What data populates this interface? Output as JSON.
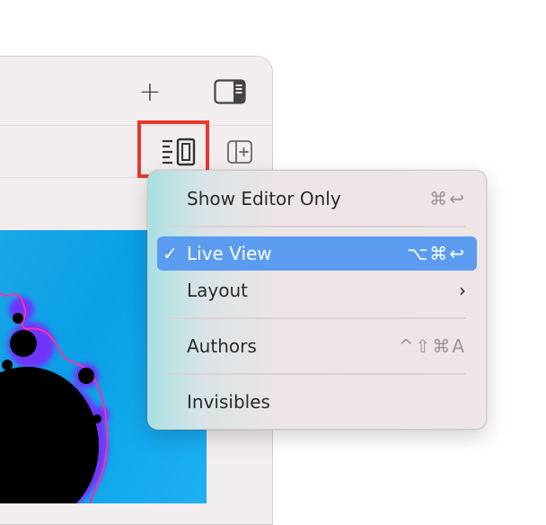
{
  "toolbar": {
    "plus_icon": "plus-icon",
    "plus_glyph": "+",
    "sidebar_icon": "sidebar-toggle-icon",
    "editor_mode_icon": "editor-mode-icon",
    "add_pane_icon": "add-pane-icon"
  },
  "menu": {
    "items": [
      {
        "label": "Show Editor Only",
        "shortcut": "⌘↩",
        "selected": false,
        "checked": false
      },
      {
        "label": "Live View",
        "shortcut": "⌥⌘↩",
        "selected": true,
        "checked": true,
        "check_glyph": "✓"
      },
      {
        "label": "Layout",
        "submenu_glyph": "›",
        "selected": false,
        "checked": false
      },
      {
        "label": "Authors",
        "shortcut": "^⇧⌘A",
        "selected": false,
        "checked": false
      },
      {
        "label": "Invisibles",
        "selected": false,
        "checked": false
      }
    ]
  },
  "colors": {
    "highlight": "#e8392c",
    "selection": "#5b9cf0",
    "fractal_bg": "#0a9fe6"
  }
}
